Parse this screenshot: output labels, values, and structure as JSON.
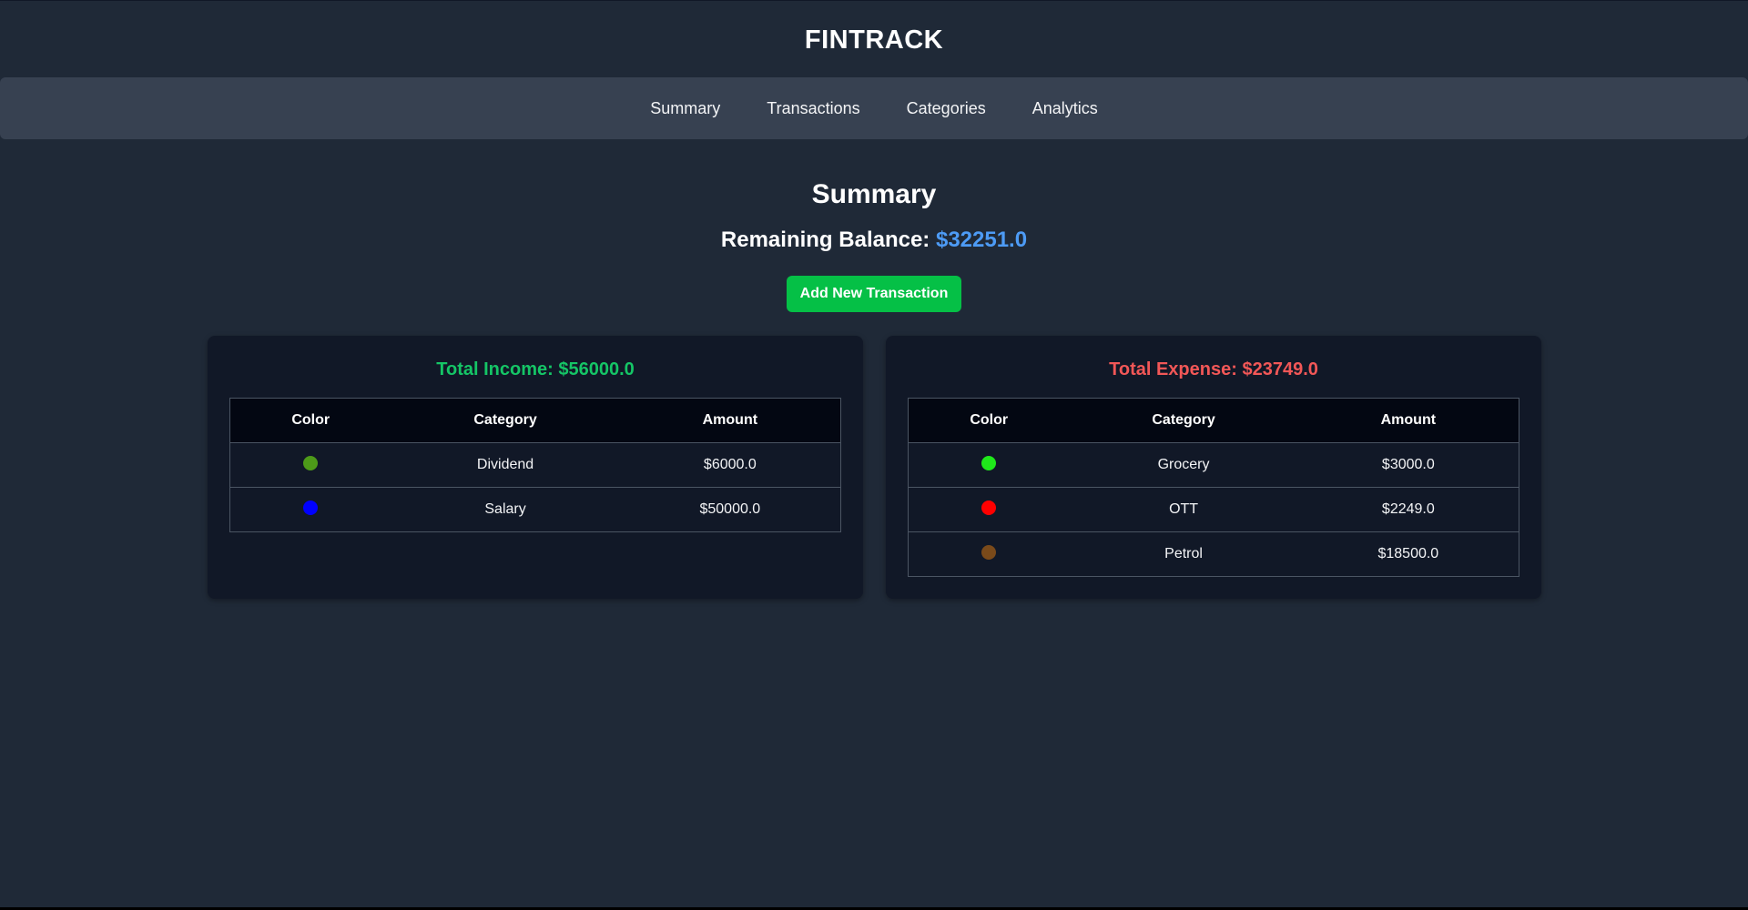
{
  "header": {
    "title": "FINTRACK"
  },
  "nav": {
    "items": [
      "Summary",
      "Transactions",
      "Categories",
      "Analytics"
    ]
  },
  "main": {
    "title": "Summary",
    "balance_label": "Remaining Balance: ",
    "balance_value": "$32251.0",
    "add_button_label": "Add New Transaction"
  },
  "income": {
    "title": "Total Income: $56000.0",
    "columns": [
      "Color",
      "Category",
      "Amount"
    ],
    "rows": [
      {
        "color": "#4d9a19",
        "category": "Dividend",
        "amount": "$6000.0"
      },
      {
        "color": "#0000ff",
        "category": "Salary",
        "amount": "$50000.0"
      }
    ]
  },
  "expense": {
    "title": "Total Expense: $23749.0",
    "columns": [
      "Color",
      "Category",
      "Amount"
    ],
    "rows": [
      {
        "color": "#1fe81a",
        "category": "Grocery",
        "amount": "$3000.0"
      },
      {
        "color": "#ff0000",
        "category": "OTT",
        "amount": "$2249.0"
      },
      {
        "color": "#7a4a1a",
        "category": "Petrol",
        "amount": "$18500.0"
      }
    ]
  },
  "theme": {
    "background": "#1f2937",
    "navbar": "#374151",
    "card": "#111827",
    "income_accent": "#15c566",
    "expense_accent": "#f25757",
    "balance_accent": "#4d9bf5",
    "button": "#05c046"
  }
}
